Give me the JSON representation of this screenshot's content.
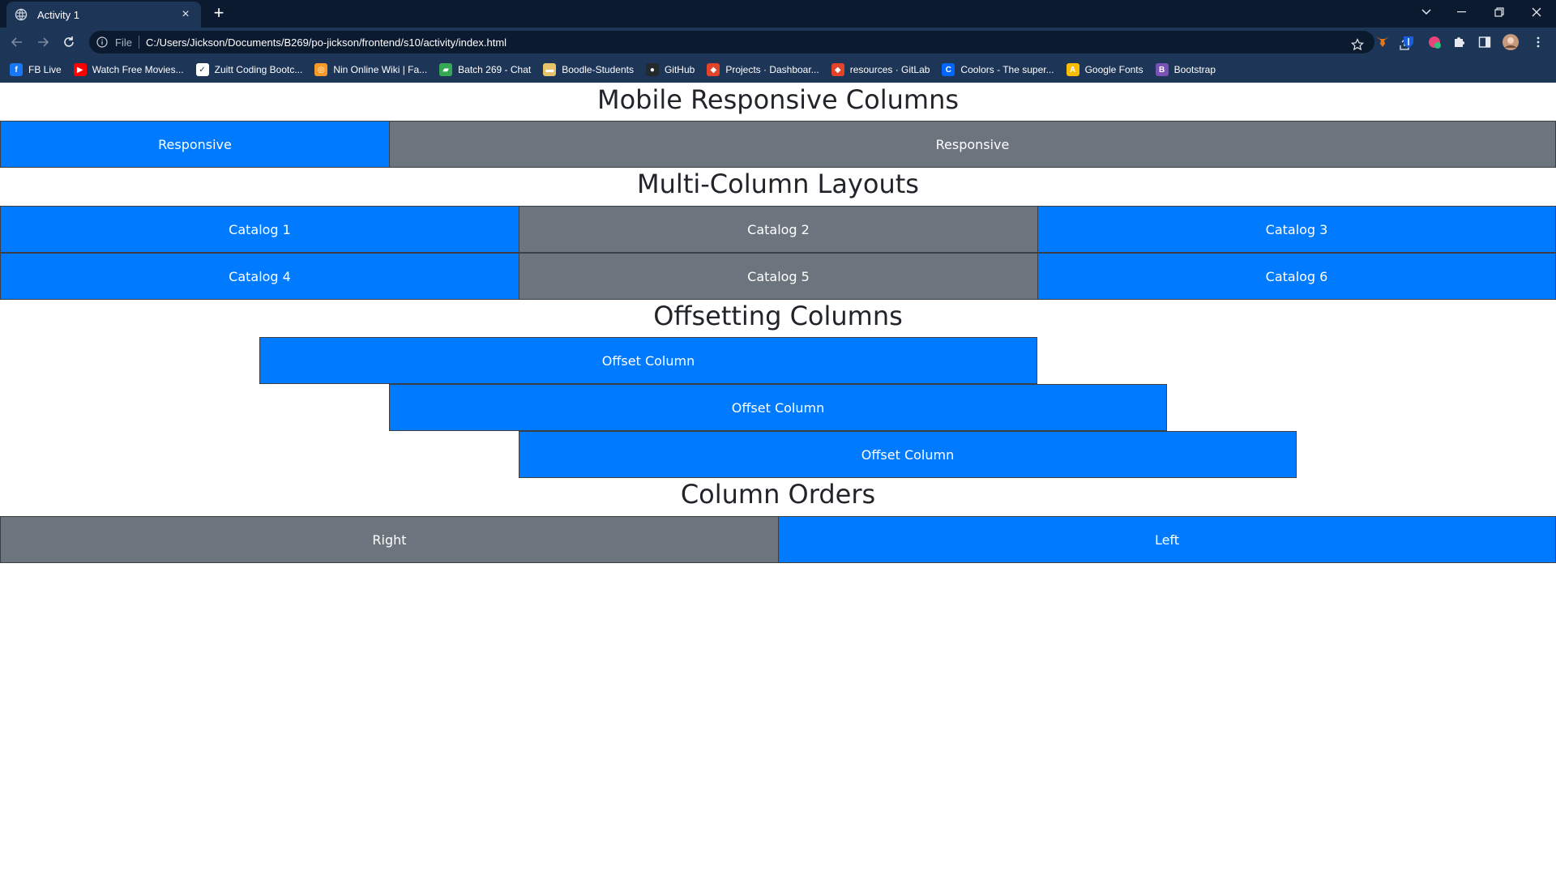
{
  "browser": {
    "tab_title": "Activity 1",
    "tab_close": "×",
    "new_tab": "+",
    "scheme": "File",
    "url": "C:/Users/Jickson/Documents/B269/po-jickson/frontend/s10/activity/index.html",
    "bookmarks": [
      {
        "label": "FB Live",
        "icon": "facebook-icon",
        "color": "#1877f2",
        "glyph": "f"
      },
      {
        "label": "Watch Free Movies...",
        "icon": "youtube-icon",
        "color": "#ff0000",
        "glyph": "▶"
      },
      {
        "label": "Zuitt Coding Bootc...",
        "icon": "zuitt-icon",
        "color": "#ffffff",
        "glyph": "✓"
      },
      {
        "label": "Nin Online Wiki | Fa...",
        "icon": "fandom-icon",
        "color": "#f79a2a",
        "glyph": "◎"
      },
      {
        "label": "Batch 269 - Chat",
        "icon": "google-chat-icon",
        "color": "#34a853",
        "glyph": "▰"
      },
      {
        "label": "Boodle-Students",
        "icon": "boodle-icon",
        "color": "#e8c26a",
        "glyph": "▬"
      },
      {
        "label": "GitHub",
        "icon": "github-icon",
        "color": "#24292e",
        "glyph": "●"
      },
      {
        "label": "Projects · Dashboar...",
        "icon": "gitlab-icon",
        "color": "#e24329",
        "glyph": "◆"
      },
      {
        "label": "resources · GitLab",
        "icon": "gitlab-icon",
        "color": "#e24329",
        "glyph": "◆"
      },
      {
        "label": "Coolors - The super...",
        "icon": "coolors-icon",
        "color": "#0066ff",
        "glyph": "C"
      },
      {
        "label": "Google Fonts",
        "icon": "google-fonts-icon",
        "color": "#fbbc04",
        "glyph": "A"
      },
      {
        "label": "Bootstrap",
        "icon": "bootstrap-icon",
        "color": "#7952b3",
        "glyph": "B"
      }
    ]
  },
  "sections": {
    "responsive": {
      "title": "Mobile Responsive Columns",
      "columns": [
        "Responsive",
        "Responsive"
      ]
    },
    "multi": {
      "title": "Multi-Column Layouts",
      "columns": [
        "Catalog 1",
        "Catalog 2",
        "Catalog 3",
        "Catalog 4",
        "Catalog 5",
        "Catalog 6"
      ]
    },
    "offset": {
      "title": "Offsetting Columns",
      "columns": [
        "Offset Column",
        "Offset Column",
        "Offset Column"
      ]
    },
    "order": {
      "title": "Column Orders",
      "columns": [
        "Right",
        "Left"
      ]
    }
  },
  "colors": {
    "primary": "#007bff",
    "secondary": "#6c757d"
  }
}
